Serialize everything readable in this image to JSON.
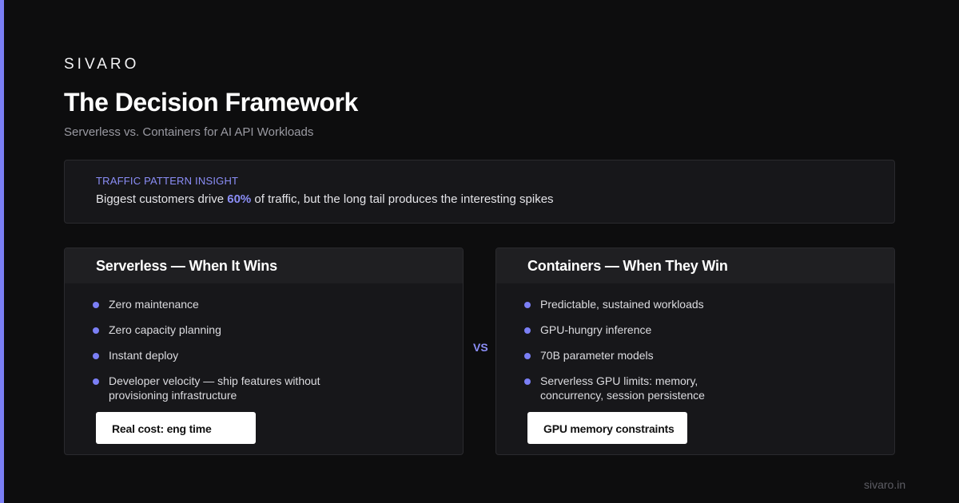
{
  "brand": "SIVARO",
  "title": "The Decision Framework",
  "subtitle": "Serverless vs. Containers for AI API Workloads",
  "insight": {
    "label": "TRAFFIC PATTERN INSIGHT",
    "text_before": "Biggest customers drive ",
    "highlight": "60%",
    "text_after": " of traffic, but the long tail produces the interesting spikes"
  },
  "left": {
    "title": "Serverless — When It Wins",
    "points": [
      "Zero maintenance",
      "Zero capacity planning",
      "Instant deploy",
      "Developer velocity — ship features without provisioning infrastructure"
    ],
    "callout": "Real cost: eng time"
  },
  "vs": "VS",
  "right": {
    "title": "Containers — When They Win",
    "points": [
      "Predictable, sustained workloads",
      "GPU-hungry inference",
      "70B parameter models",
      "Serverless GPU limits: memory, concurrency, session persistence"
    ],
    "callout": "GPU memory constraints"
  },
  "footer": "sivaro.in",
  "colors": {
    "accent": "#7b7ff5",
    "background": "#0d0d0e",
    "card": "#17171a"
  }
}
